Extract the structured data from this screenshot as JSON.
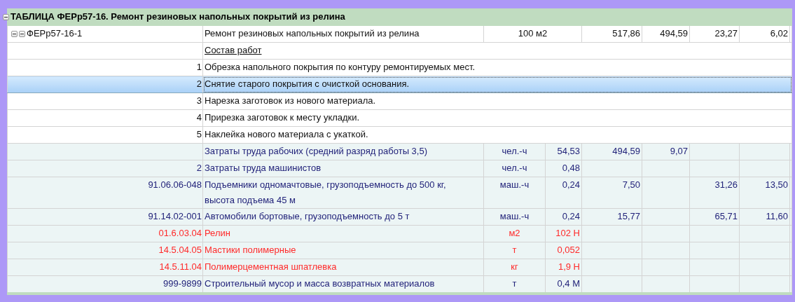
{
  "section": {
    "title": "ТАБЛИЦА ФЕРр57-16. Ремонт резиновых напольных покрытий из релина",
    "expanded": true
  },
  "norm": {
    "code": "ФЕРр57-16-1",
    "expanded": true,
    "name": "Ремонт резиновых напольных покрытий из релина",
    "unit": "100 м2",
    "value_1": "517,86",
    "value_2": "494,59",
    "value_3": "23,27",
    "value_4": "6,02"
  },
  "works": {
    "heading": "Состав работ",
    "steps": [
      {
        "number": "1",
        "text": "Обрезка напольного покрытия по контуру ремонтируемых мест.",
        "selected": false
      },
      {
        "number": "2",
        "text": "Снятие старого покрытия с очисткой основания.",
        "selected": true
      },
      {
        "number": "3",
        "text": "Нарезка заготовок из нового материала.",
        "selected": false
      },
      {
        "number": "4",
        "text": "Прирезка заготовок к месту укладки.",
        "selected": false
      },
      {
        "number": "5",
        "text": "Наклейка нового материала с укаткой.",
        "selected": false
      }
    ]
  },
  "resources": [
    {
      "kind": "labor",
      "name": "Затраты труда рабочих (средний разряд работы 3,5)",
      "unit": "чел.-ч",
      "quantity": "54,53",
      "value_1": "494,59",
      "value_2": "9,07"
    },
    {
      "kind": "labor",
      "code": "2",
      "name": "Затраты труда машинистов",
      "unit": "чел.-ч",
      "quantity": "0,48"
    },
    {
      "kind": "machine",
      "code": "91.06.06-048",
      "name": "Подъемники одномачтовые, грузоподъемность до 500 кг,\nвысота подъема 45 м",
      "unit": "маш.-ч",
      "quantity": "0,24",
      "value_1": "7,50",
      "value_3": "31,26",
      "value_4": "13,50"
    },
    {
      "kind": "machine",
      "code": "91.14.02-001",
      "name": "Автомобили бортовые, грузоподъемность до 5 т",
      "unit": "маш.-ч",
      "quantity": "0,24",
      "value_1": "15,77",
      "value_3": "65,71",
      "value_4": "11,60"
    },
    {
      "kind": "material",
      "code": "01.6.03.04",
      "name": "Релин",
      "unit": "м2",
      "quantity": "102 Н"
    },
    {
      "kind": "material",
      "code": "14.5.04.05",
      "name": "Мастики полимерные",
      "unit": "т",
      "quantity": "0,052"
    },
    {
      "kind": "material",
      "code": "14.5.11.04",
      "name": "Полимерцементная шпатлевка",
      "unit": "кг",
      "quantity": "1,9 Н"
    },
    {
      "kind": "waste",
      "code": "999-9899",
      "name": "Строительный мусор и масса возвратных материалов",
      "unit": "т",
      "quantity": "0,4 М"
    }
  ]
}
